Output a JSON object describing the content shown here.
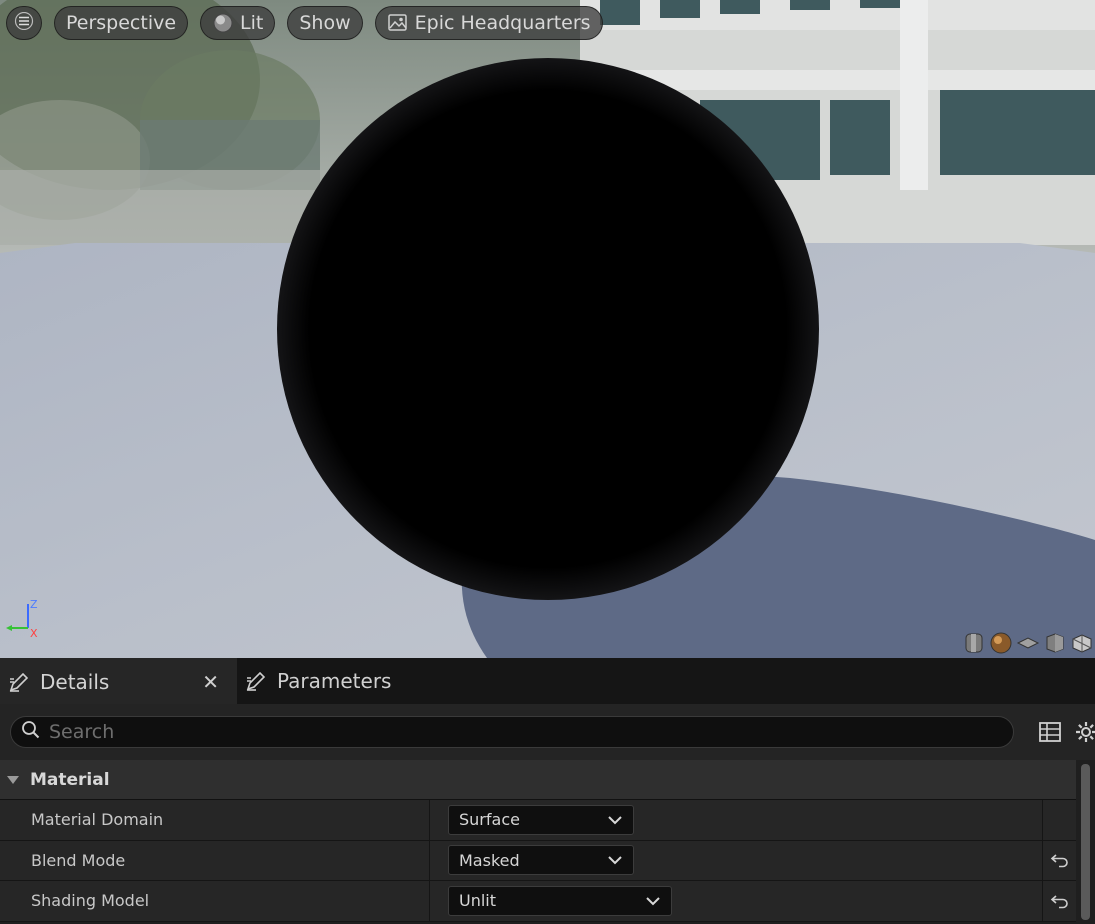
{
  "viewport": {
    "toolbar": {
      "view_mode": "Perspective",
      "lighting": "Lit",
      "show": "Show",
      "environment": "Epic Headquarters"
    },
    "axis": {
      "z": "Z",
      "x": "X"
    },
    "preview_shapes": [
      "cylinder-icon",
      "sphere-icon",
      "plane-icon",
      "cube-icon",
      "mesh-icon"
    ],
    "colors": {
      "sphere": "#000000",
      "floor": "#b3bac6"
    }
  },
  "panel": {
    "tabs": [
      {
        "label": "Details",
        "active": true
      },
      {
        "label": "Parameters",
        "active": false
      }
    ],
    "search": {
      "placeholder": "Search",
      "value": ""
    },
    "category": "Material",
    "properties": [
      {
        "name": "Material Domain",
        "value": "Surface",
        "resettable": false
      },
      {
        "name": "Blend Mode",
        "value": "Masked",
        "resettable": true
      },
      {
        "name": "Shading Model",
        "value": "Unlit",
        "resettable": true
      }
    ]
  }
}
